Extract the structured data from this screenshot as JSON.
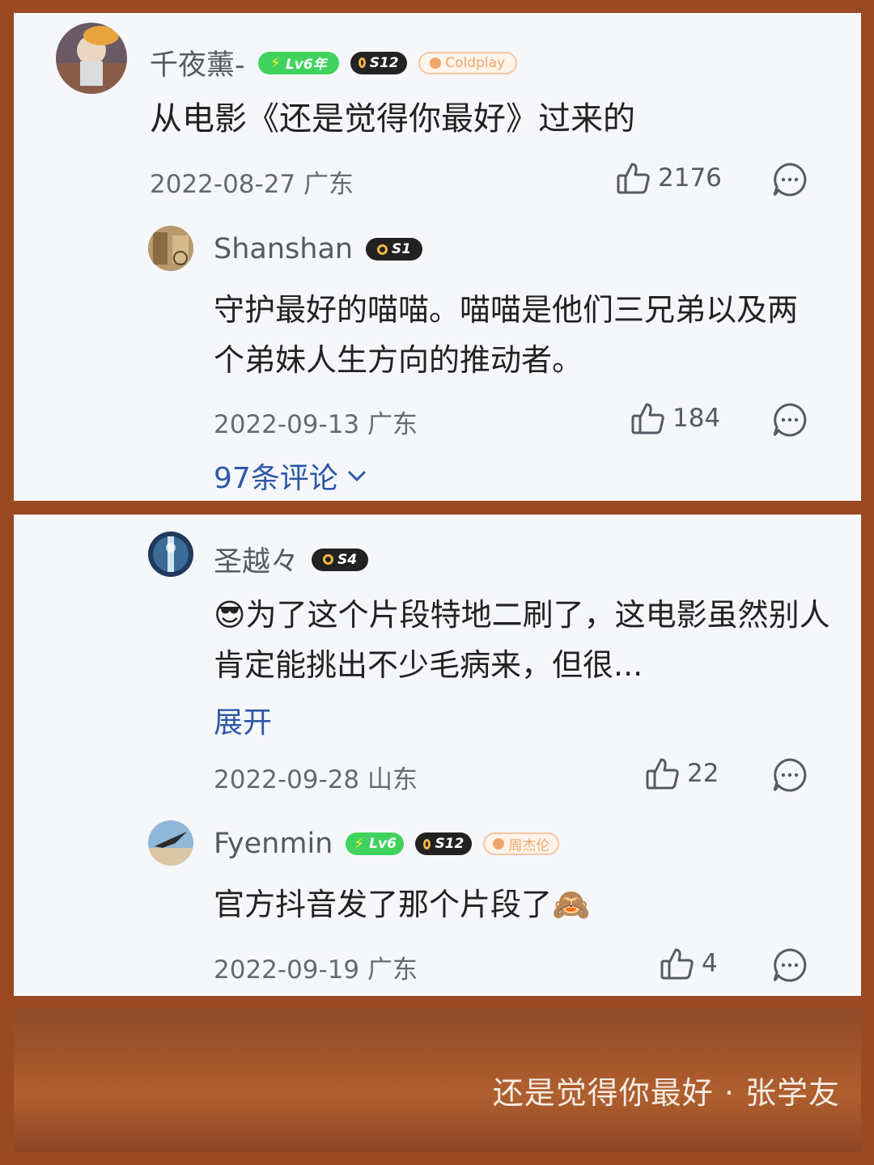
{
  "comments": [
    {
      "username": "千夜薰-",
      "level_badge": "Lv6年",
      "s_badge": "S12",
      "fan_badge": "Coldplay",
      "text": "从电影《还是觉得你最好》过来的",
      "date": "2022-08-27",
      "location": "广东",
      "likes": "2176"
    },
    {
      "username": "Shanshan",
      "s_badge": "S1",
      "text": "守护最好的喵喵。喵喵是他们三兄弟以及两个弟妹人生方向的推动者。",
      "date": "2022-09-13",
      "location": "广东",
      "likes": "184",
      "more_replies": "97条评论"
    },
    {
      "username": "圣越々",
      "s_badge": "S4",
      "emoji": "😎",
      "text": "为了这个片段特地二刷了，这电影虽然别人肯定能挑出不少毛病来，但很...",
      "expand": "展开",
      "date": "2022-09-28",
      "location": "山东",
      "likes": "22"
    },
    {
      "username": "Fyenmin",
      "level_badge": "Lv6",
      "s_badge": "S12",
      "fan_badge": "周杰伦",
      "text": "官方抖音发了那个片段了",
      "emoji": "🙈",
      "date": "2022-09-19",
      "location": "广东",
      "likes": "4"
    }
  ],
  "footer": {
    "caption": "还是觉得你最好 · 张学友"
  },
  "colors": {
    "background": "#9a4a22",
    "panel": "#f6f7fa",
    "link": "#2d58a8",
    "level_badge": "#3fd35e"
  },
  "icons": [
    "thumb-up-icon",
    "comment-bubble-icon",
    "chevron-down-icon",
    "lightning-icon"
  ]
}
